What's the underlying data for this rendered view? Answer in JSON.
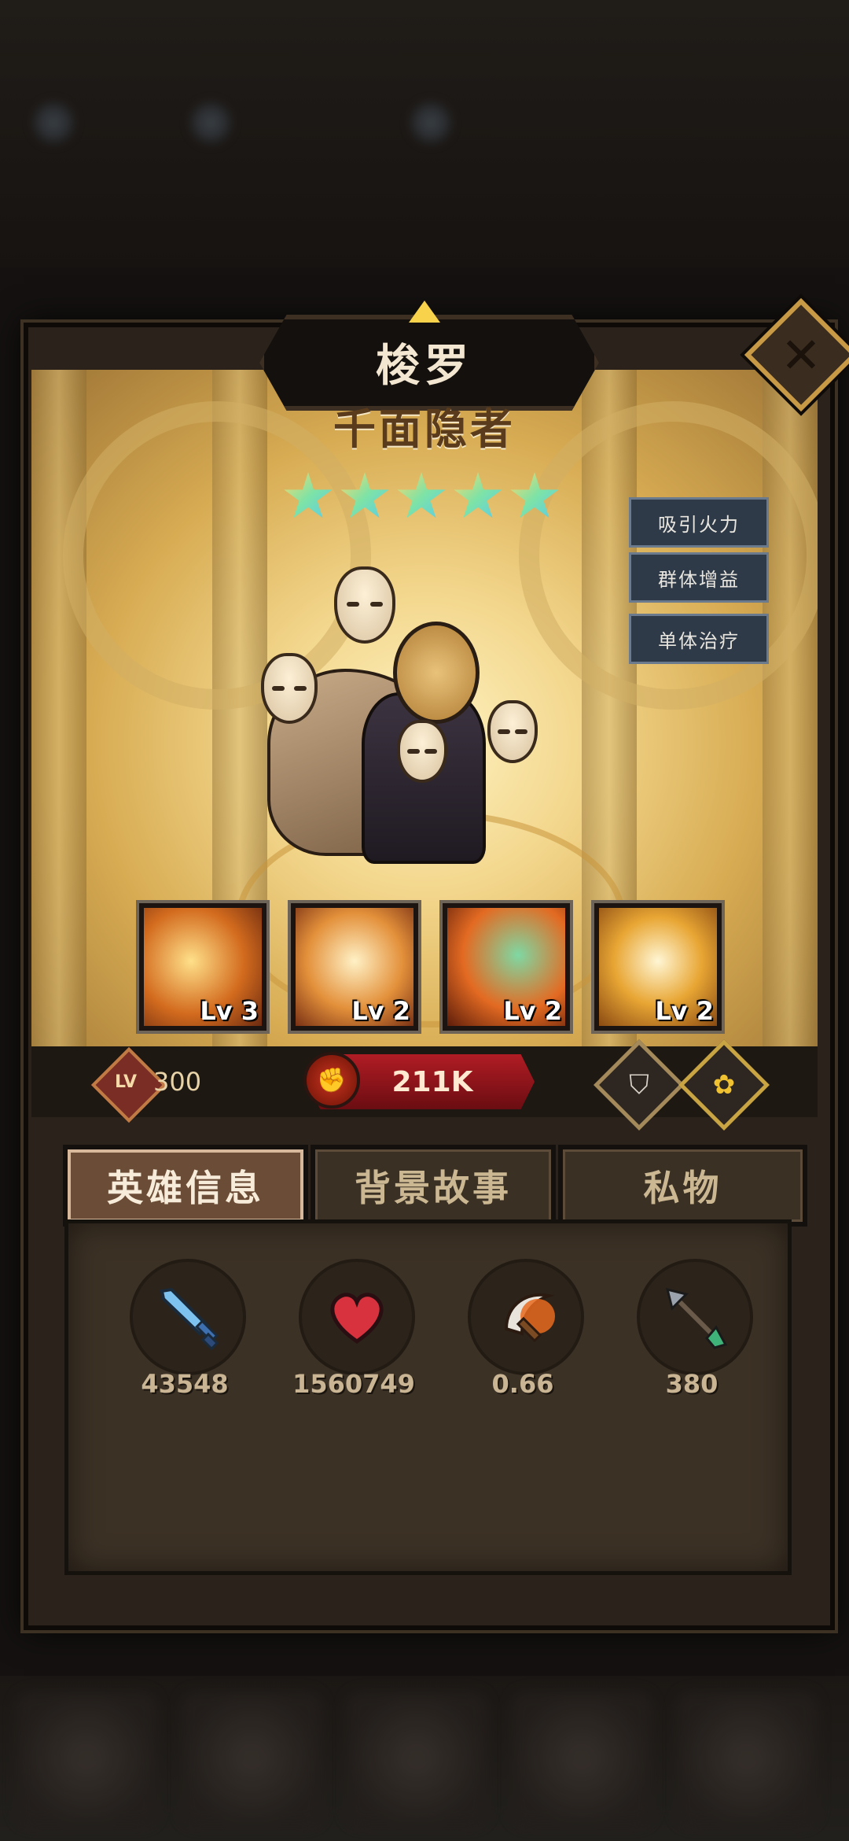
{
  "hero": {
    "name": "梭罗",
    "title": "千面隐者",
    "stars": 5,
    "tags": [
      "吸引火力",
      "群体增益",
      "单体治疗"
    ]
  },
  "skills": [
    {
      "level_label": "Lv 3"
    },
    {
      "level_label": "Lv 2"
    },
    {
      "level_label": "Lv 2"
    },
    {
      "level_label": "Lv 2"
    }
  ],
  "stats_bar": {
    "lv_label": "LV",
    "level": "300",
    "power": "211K"
  },
  "tabs": [
    "英雄信息",
    "背景故事",
    "私物"
  ],
  "active_tab": 0,
  "attributes": [
    {
      "icon": "sword-icon",
      "value": "43548"
    },
    {
      "icon": "heart-icon",
      "value": "1560749"
    },
    {
      "icon": "crescent-blade-icon",
      "value": "0.66"
    },
    {
      "icon": "arrow-icon",
      "value": "380"
    }
  ],
  "colors": {
    "power_red": "#b11c24",
    "tag_blue": "#2f3a48",
    "frame_gold": "#c99a46"
  }
}
